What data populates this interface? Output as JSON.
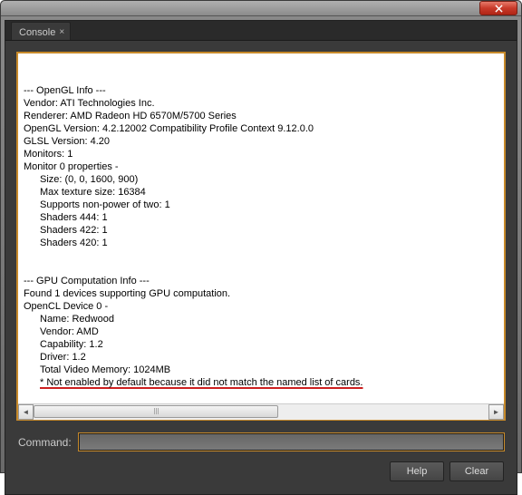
{
  "tab": {
    "label": "Console"
  },
  "opengl": {
    "header": "--- OpenGL Info ---",
    "vendor": "Vendor: ATI Technologies Inc.",
    "renderer": "Renderer: AMD Radeon HD 6570M/5700 Series",
    "version": "OpenGL Version: 4.2.12002 Compatibility Profile Context 9.12.0.0",
    "glsl": "GLSL Version: 4.20",
    "monitors": "Monitors: 1",
    "monitor0": "Monitor 0 properties -",
    "size": "Size: (0, 0, 1600, 900)",
    "maxtex": "Max texture size: 16384",
    "npot": "Supports non-power of two: 1",
    "sh444": "Shaders 444: 1",
    "sh422": "Shaders 422: 1",
    "sh420": "Shaders 420: 1"
  },
  "gpu": {
    "header": "--- GPU Computation Info ---",
    "found": "Found 1 devices supporting GPU computation.",
    "dev0": "OpenCL Device 0 -",
    "name": "Name: Redwood",
    "vendor": "Vendor: AMD",
    "cap": "Capability: 1.2",
    "driver": "Driver: 1.2",
    "vram": "Total Video Memory: 1024MB",
    "warn": "* Not enabled by default because it did not match the named list of cards."
  },
  "command": {
    "label": "Command:",
    "value": ""
  },
  "buttons": {
    "help": "Help",
    "clear": "Clear"
  }
}
